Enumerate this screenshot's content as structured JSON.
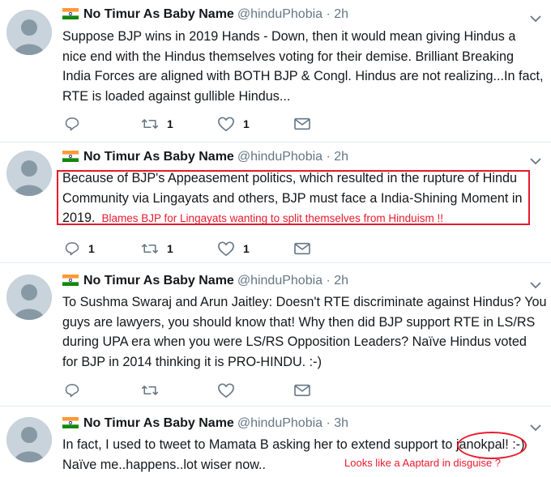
{
  "tweets": [
    {
      "name": "No Timur As Baby Name",
      "handle": "@hinduPhobia",
      "separator": "·",
      "time": "2h",
      "lines": [
        "Suppose BJP wins in 2019 Hands - Down, then it would mean giving Hindus a",
        "nice end with the Hindus themselves voting for their demise. Brilliant Breaking",
        "India Forces are aligned with BOTH BJP & Congl. Hindus are not realizing...In fact,",
        "RTE is loaded against gullible Hindus..."
      ],
      "reply_count": "",
      "retweet_count": "1",
      "like_count": "1"
    },
    {
      "name": "No Timur As Baby Name",
      "handle": "@hinduPhobia",
      "separator": "·",
      "time": "2h",
      "lines": [
        "Because of BJP's Appeasement politics, which resulted in the rupture of Hindu",
        "Community via Lingayats and others, BJP must face a India-Shining Moment in",
        "2019."
      ],
      "annotation": "Blames BJP for Lingayats wanting to split themselves from Hinduism !!",
      "reply_count": "1",
      "retweet_count": "1",
      "like_count": "1"
    },
    {
      "name": "No Timur As Baby Name",
      "handle": "@hinduPhobia",
      "separator": "·",
      "time": "2h",
      "lines": [
        "To Sushma Swaraj and Arun Jaitley: Doesn't RTE discriminate against Hindus? You",
        "guys are lawyers, you should know that! Why then did BJP support RTE in LS/RS",
        "during UPA era when you were LS/RS Opposition Leaders? Naïve Hindus voted",
        "for BJP in 2014 thinking it is PRO-HINDU. :-)"
      ],
      "reply_count": "",
      "retweet_count": "",
      "like_count": ""
    },
    {
      "name": "No Timur As Baby Name",
      "handle": "@hinduPhobia",
      "separator": "·",
      "time": "3h",
      "lines": [
        "In fact, I used to tweet to Mamata B asking her to extend support to janokpal! :-)",
        "Naïve me..happens..lot wiser now.."
      ],
      "annotation": "Looks like a Aaptard in disguise ?"
    }
  ],
  "colors": {
    "annotation_red": "#e8192c",
    "icon_grey": "#657786"
  }
}
